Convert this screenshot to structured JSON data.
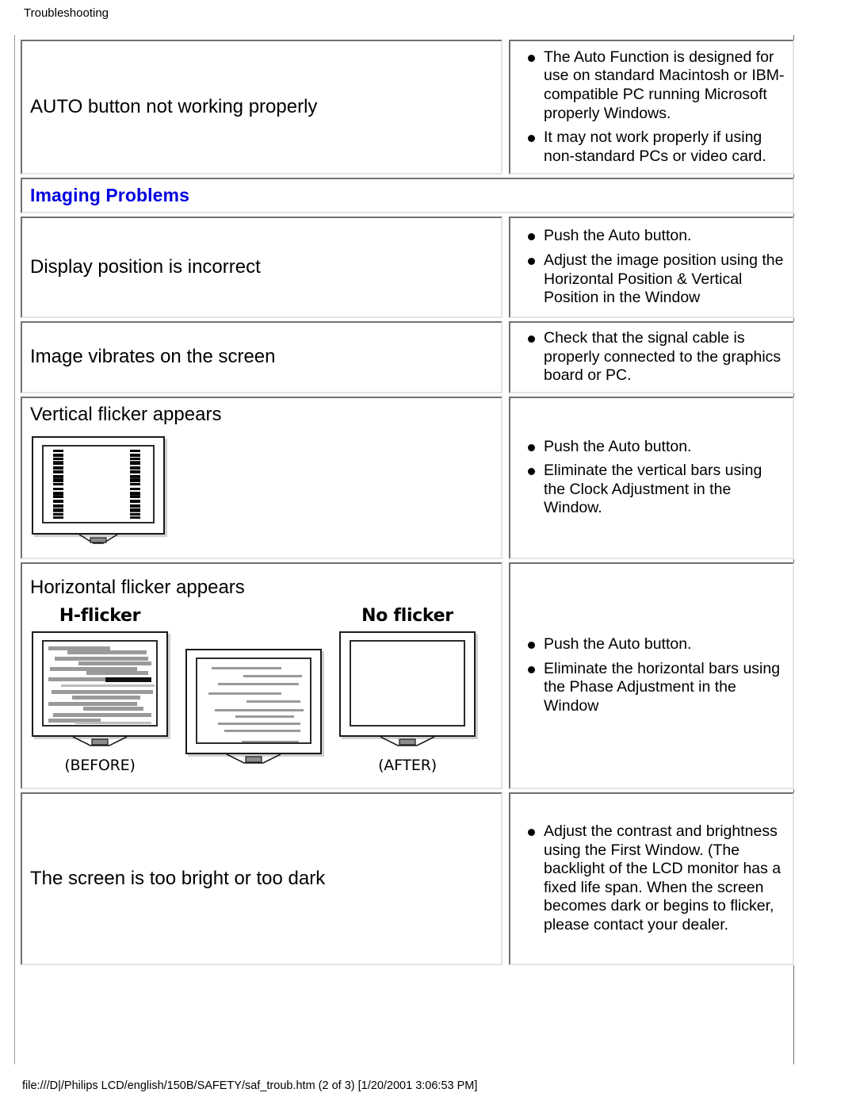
{
  "page": {
    "header": "Troubleshooting",
    "footer": "file:///D|/Philips LCD/english/150B/SAFETY/saf_troub.htm (2 of 3) [1/20/2001 3:06:53 PM]",
    "accent_blue": "#0000e0"
  },
  "rows": {
    "auto_button": {
      "problem": "AUTO button not working properly",
      "solutions": [
        "The Auto Function is designed for use on standard Macintosh or IBM-compatible PC running Microsoft properly Windows.",
        "It may not work properly if using non-standard PCs or video card."
      ]
    },
    "section_imaging": {
      "title": "Imaging Problems"
    },
    "display_position": {
      "problem": "Display position is incorrect",
      "solutions": [
        "Push the Auto button.",
        "Adjust the image position using the Horizontal Position & Vertical Position in the Window"
      ]
    },
    "image_vibrates": {
      "problem": "Image vibrates on the screen",
      "solutions": [
        "Check that the signal cable is properly connected to the graphics board or PC."
      ]
    },
    "vertical_flicker": {
      "problem": "Vertical flicker appears",
      "solutions": [
        "Push the Auto button.",
        "Eliminate the vertical bars using the Clock Adjustment in the Window."
      ],
      "illustration": "monitor-with-vertical-noise-bars"
    },
    "horizontal_flicker": {
      "problem": "Horizontal flicker appears",
      "solutions": [
        "Push the Auto button.",
        "Eliminate the horizontal bars using the Phase Adjustment in the Window"
      ],
      "illustration_captions": {
        "first_top": "H-flicker",
        "first_bottom": "(BEFORE)",
        "middle_top": "",
        "middle_bottom": "",
        "last_top": "No flicker",
        "last_bottom": "(AFTER)"
      }
    },
    "brightness": {
      "problem": "The screen is too bright or too dark",
      "solutions": [
        "Adjust the contrast and brightness using the First Window. (The backlight of the LCD monitor has a fixed life span. When the screen becomes dark or begins to flicker, please contact your dealer."
      ]
    }
  }
}
